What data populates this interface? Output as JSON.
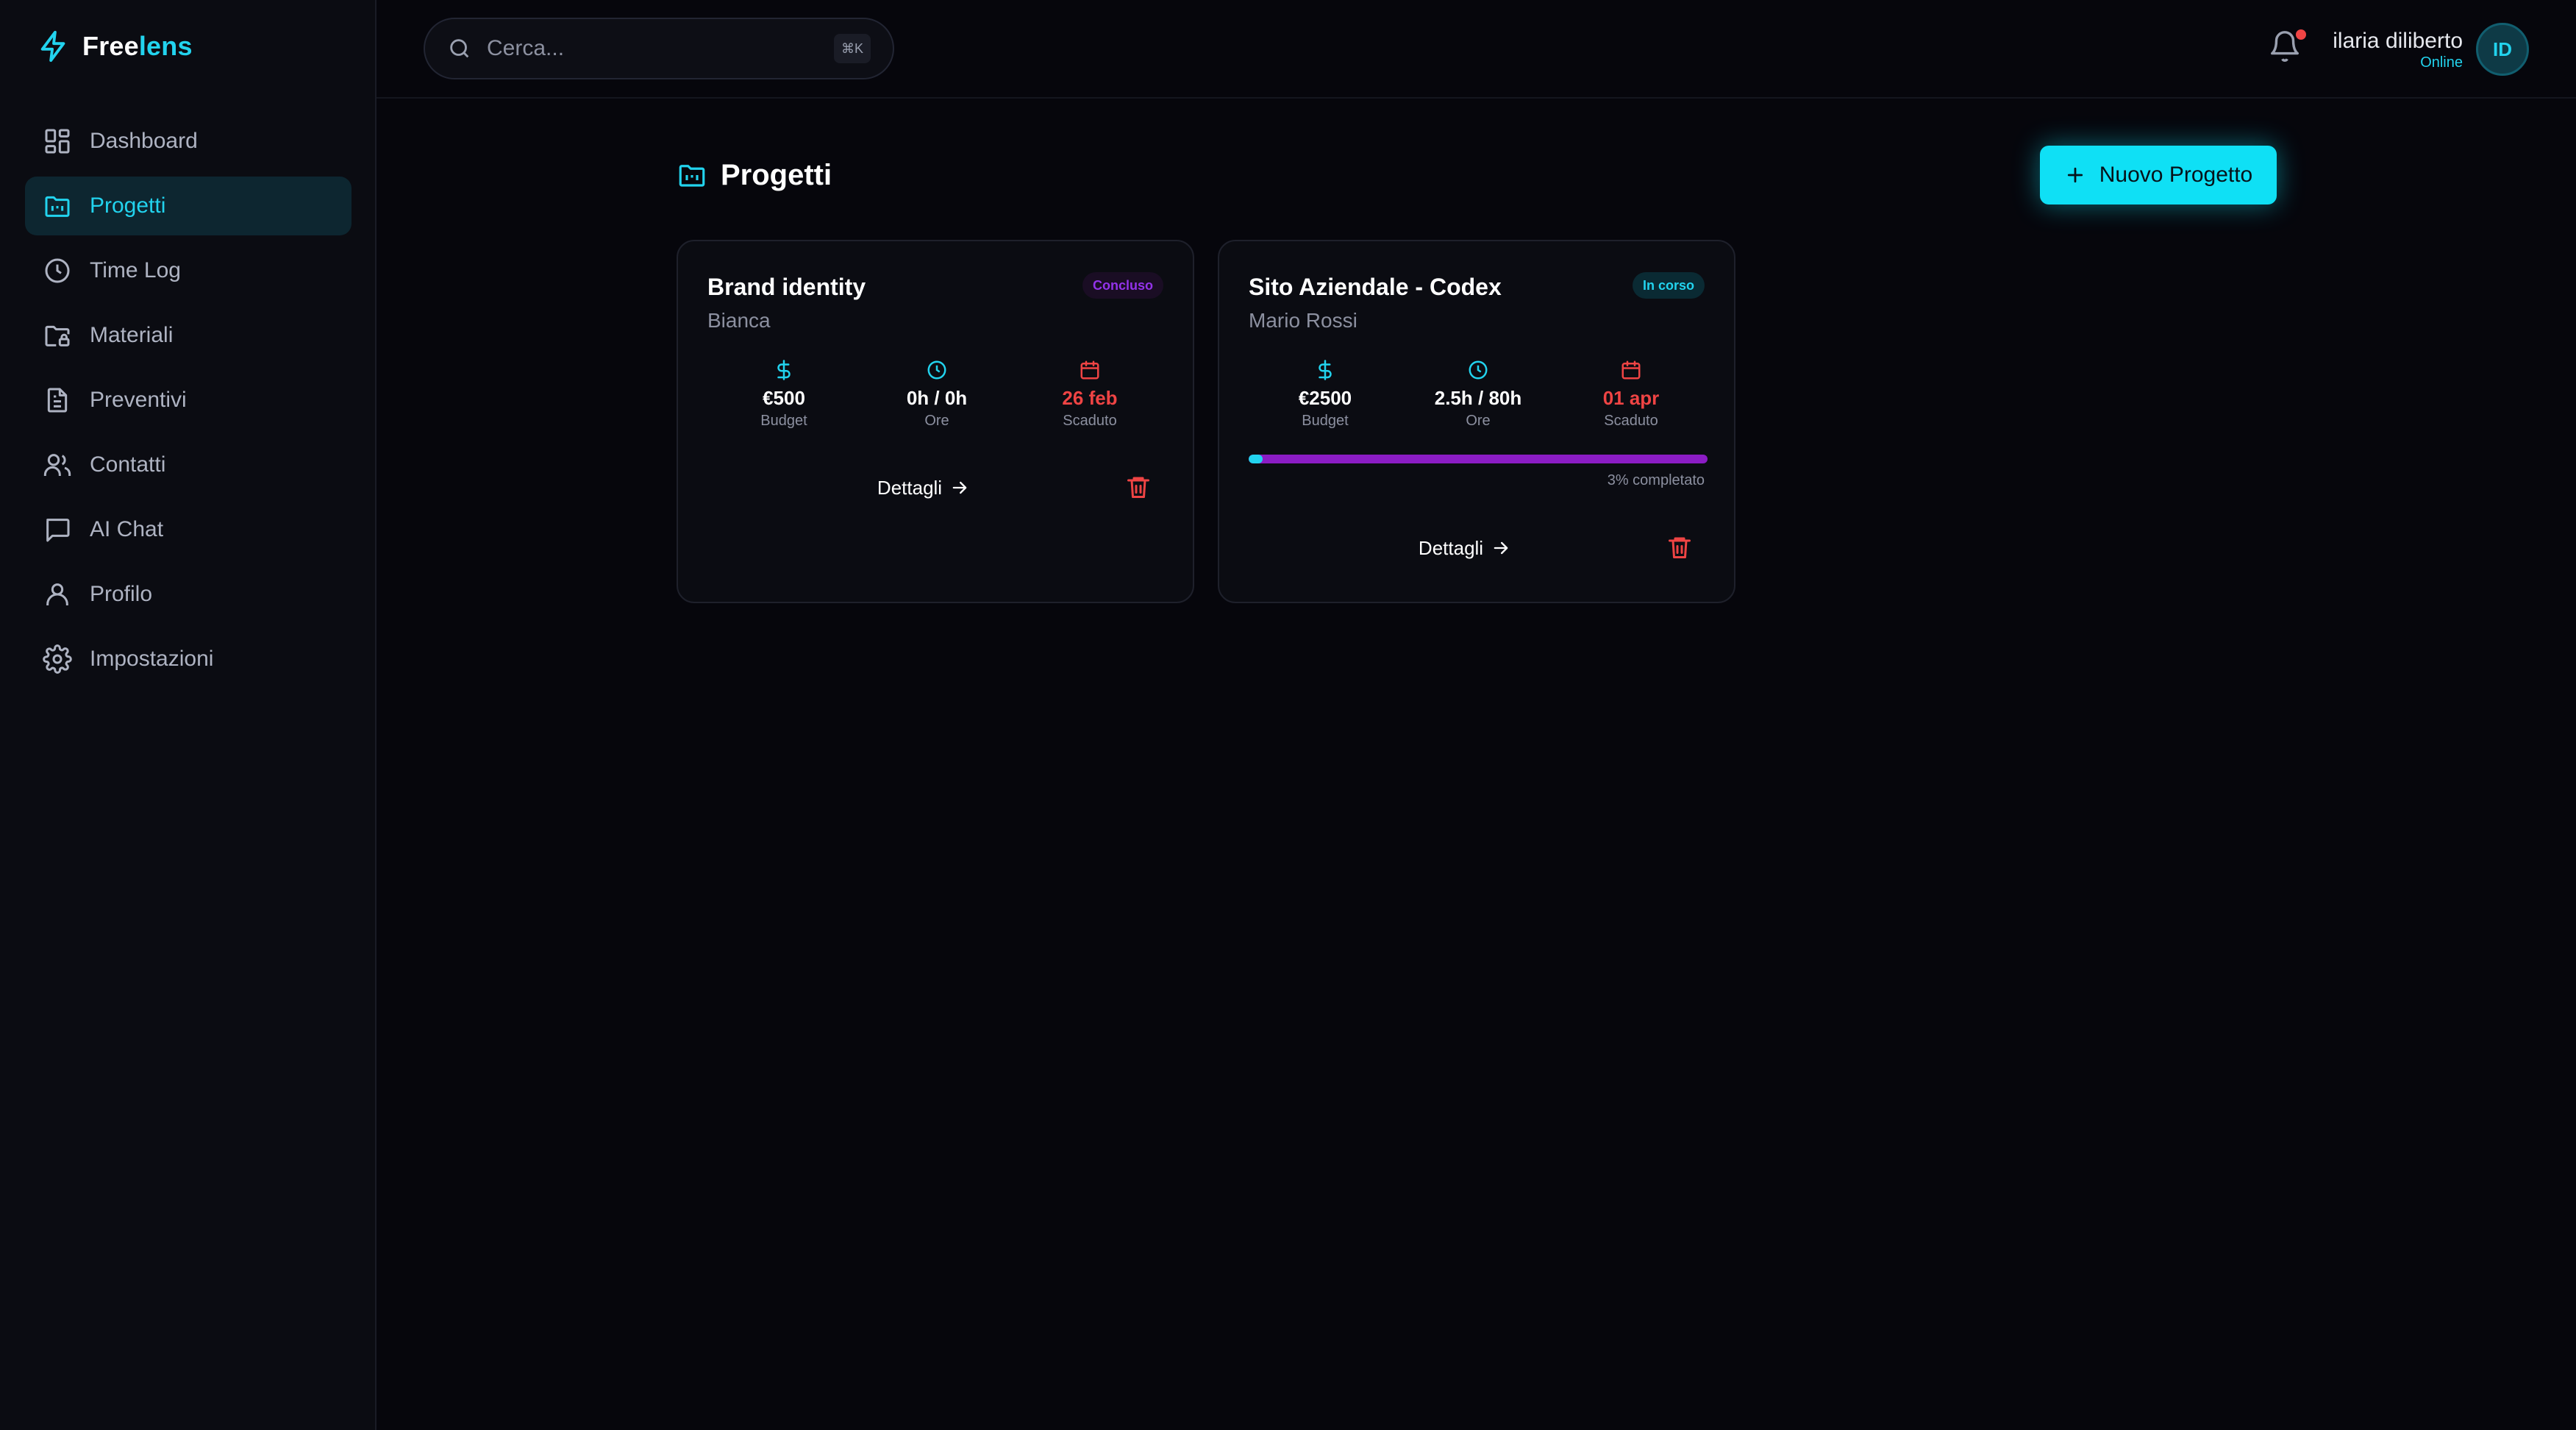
{
  "brand": {
    "name_part1": "Free",
    "name_part2": "lens",
    "accent": "#22d3ee"
  },
  "sidebar": {
    "items": [
      {
        "label": "Dashboard",
        "icon": "dashboard-icon"
      },
      {
        "label": "Progetti",
        "icon": "folder-kanban-icon",
        "active": true
      },
      {
        "label": "Time Log",
        "icon": "clock-icon"
      },
      {
        "label": "Materiali",
        "icon": "folder-lock-icon"
      },
      {
        "label": "Preventivi",
        "icon": "file-text-icon"
      },
      {
        "label": "Contatti",
        "icon": "users-icon"
      },
      {
        "label": "AI Chat",
        "icon": "message-square-icon"
      },
      {
        "label": "Profilo",
        "icon": "user-icon"
      },
      {
        "label": "Impostazioni",
        "icon": "gear-icon"
      }
    ]
  },
  "header": {
    "search_placeholder": "Cerca...",
    "search_shortcut": "⌘K",
    "notifications_unread": true,
    "user": {
      "name": "ilaria diliberto",
      "status": "Online",
      "initials": "ID"
    }
  },
  "page": {
    "title": "Progetti",
    "new_button": "Nuovo Progetto"
  },
  "projects": [
    {
      "title": "Brand identity",
      "client": "Bianca",
      "status": "Concluso",
      "budget": "€500",
      "budget_label": "Budget",
      "hours": "0h / 0h",
      "hours_label": "Ore",
      "deadline": "26 feb",
      "deadline_label": "Scaduto",
      "details_label": "Dettagli"
    },
    {
      "title": "Sito Aziendale - Codex",
      "client": "Mario Rossi",
      "status": "In corso",
      "budget": "€2500",
      "budget_label": "Budget",
      "hours": "2.5h / 80h",
      "hours_label": "Ore",
      "deadline": "01 apr",
      "deadline_label": "Scaduto",
      "progress_percent": 3,
      "progress_label": "3% completato",
      "details_label": "Dettagli"
    }
  ],
  "colors": {
    "background": "#06060c",
    "accent": "#22d3ee",
    "purple": "#8b1cc4",
    "danger": "#ef4444"
  }
}
